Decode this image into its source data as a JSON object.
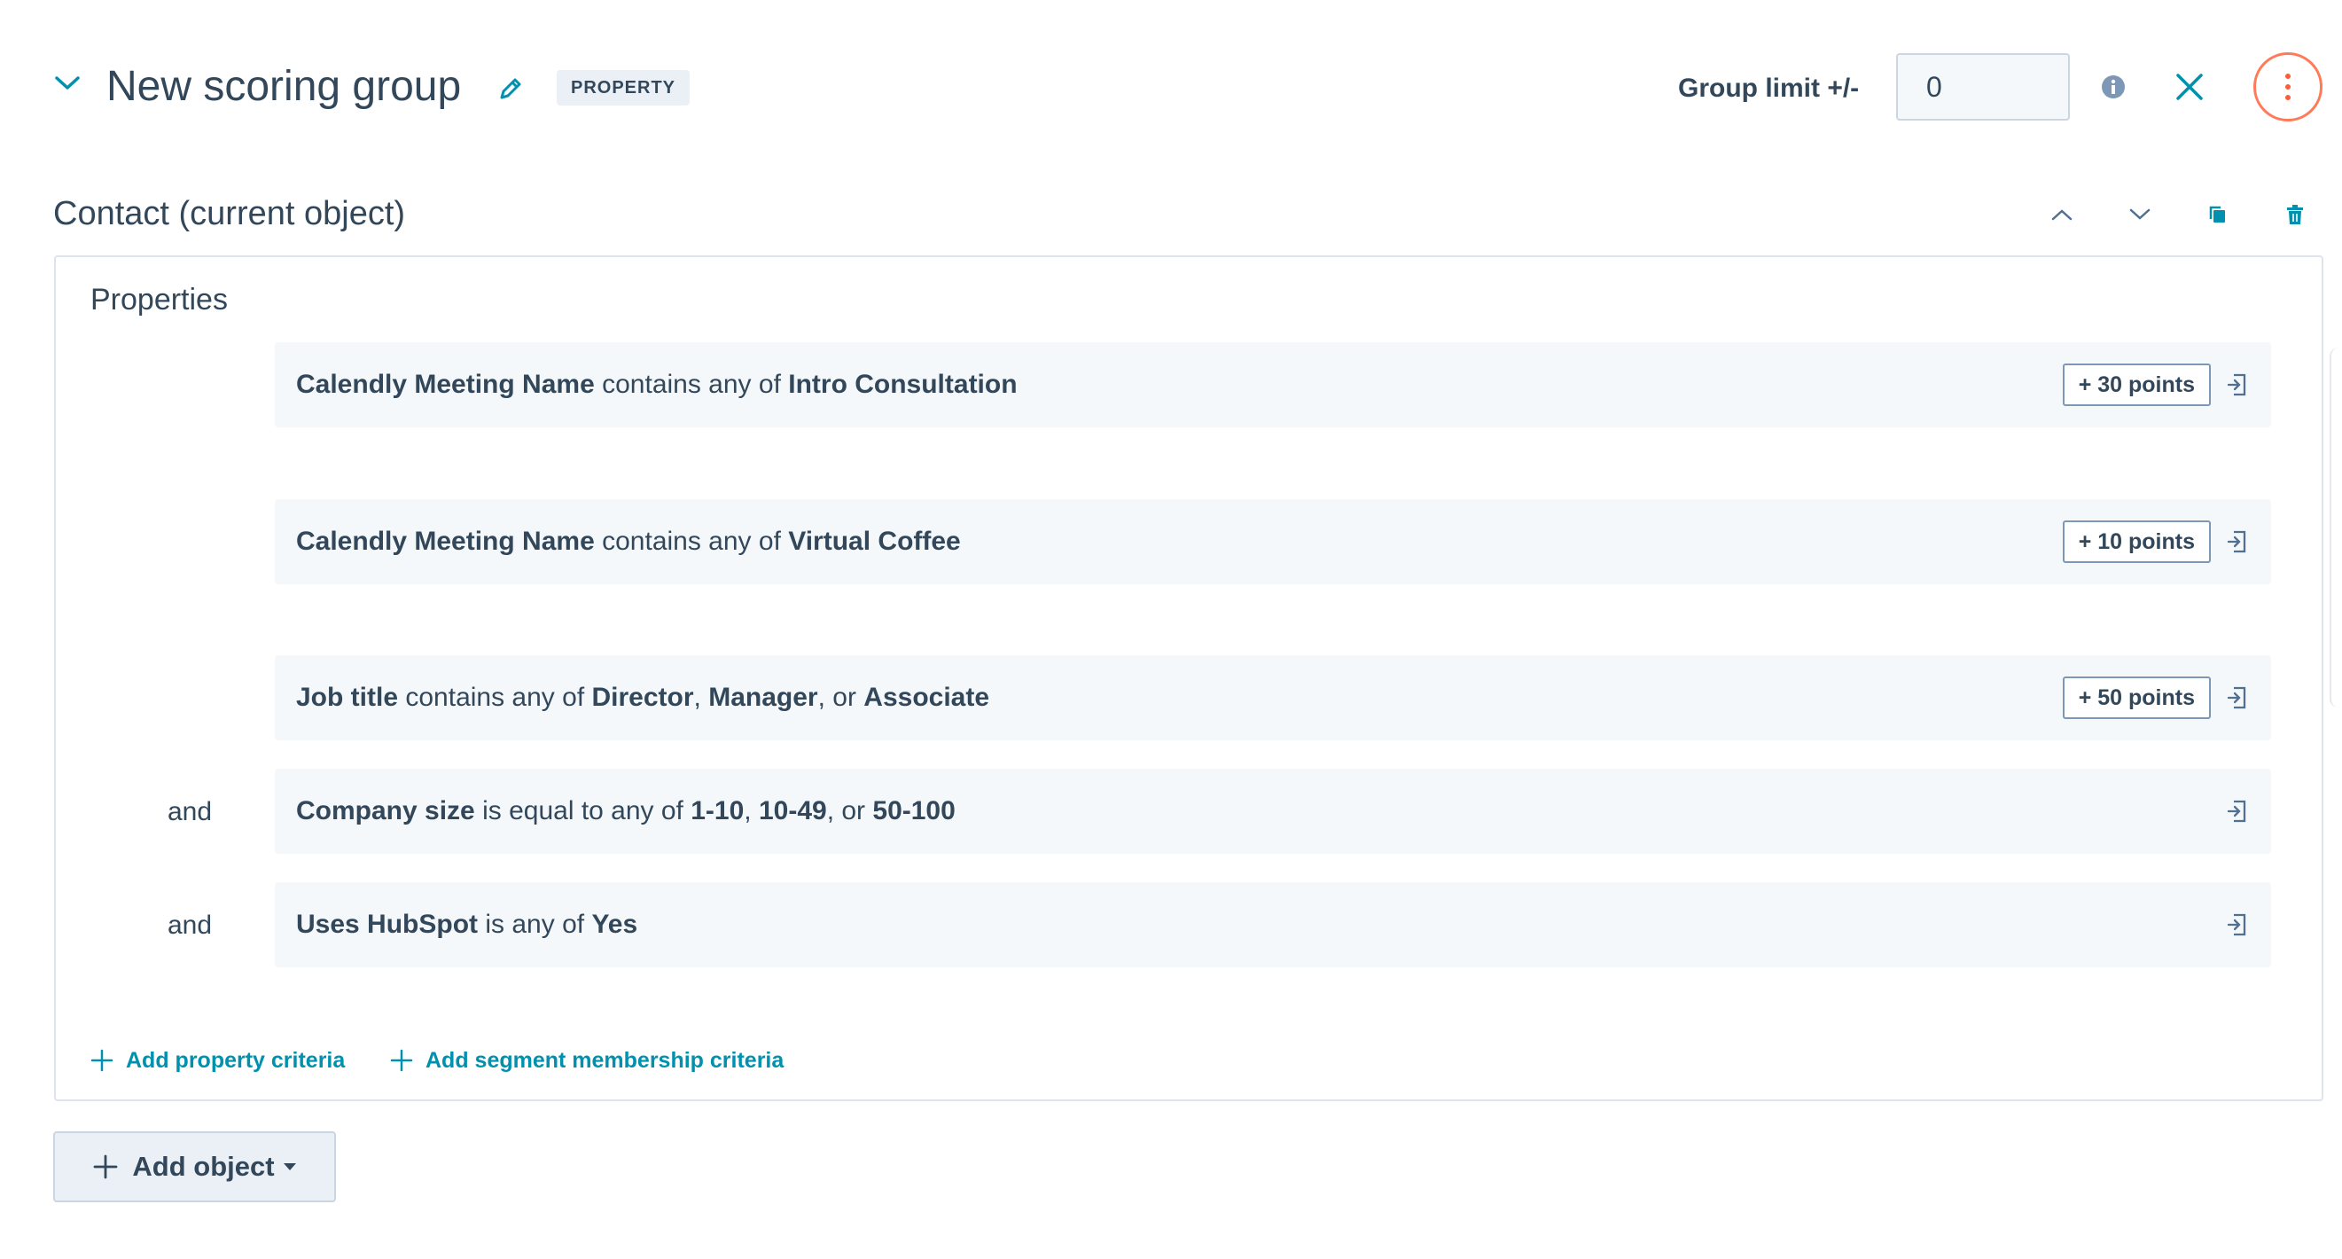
{
  "header": {
    "title": "New scoring group",
    "tag": "PROPERTY",
    "group_limit_label": "Group limit +/-",
    "group_limit_value": "0",
    "icons": {
      "collapse": "chevron-down-icon",
      "edit": "pencil-icon",
      "info": "info-icon",
      "close": "close-icon",
      "more": "vertical-ellipsis-icon"
    }
  },
  "section": {
    "title": "Contact (current object)",
    "tools": [
      "chevron-up-icon",
      "chevron-down-icon",
      "copy-icon",
      "trash-icon"
    ],
    "properties_label": "Properties",
    "criteria": [
      {
        "connector": "",
        "property": "Calendly Meeting Name",
        "operator": "contains any of",
        "values": [
          "Intro Consultation"
        ],
        "points": "+ 30 points"
      },
      {
        "connector": "",
        "property": "Calendly Meeting Name",
        "operator": "contains any of",
        "values": [
          "Virtual Coffee"
        ],
        "points": "+ 10 points"
      },
      {
        "connector": "",
        "property": "Job title",
        "operator": "contains any of",
        "values": [
          "Director",
          "Manager",
          "Associate"
        ],
        "points": "+ 50 points"
      },
      {
        "connector": "and",
        "property": "Company size",
        "operator": "is equal to any of",
        "values": [
          "1-10",
          "10-49",
          "50-100"
        ],
        "points": ""
      },
      {
        "connector": "and",
        "property": "Uses HubSpot",
        "operator": "is any of",
        "values": [
          "Yes"
        ],
        "points": ""
      }
    ],
    "add_property_criteria": "Add property criteria",
    "add_segment_criteria": "Add segment membership criteria"
  },
  "footer": {
    "add_object_label": "Add object"
  },
  "colors": {
    "text": "#33475b",
    "link": "#0091ae",
    "accent": "#ff7a59",
    "row_bg": "#f5f8fa",
    "border": "#dfe3eb"
  }
}
